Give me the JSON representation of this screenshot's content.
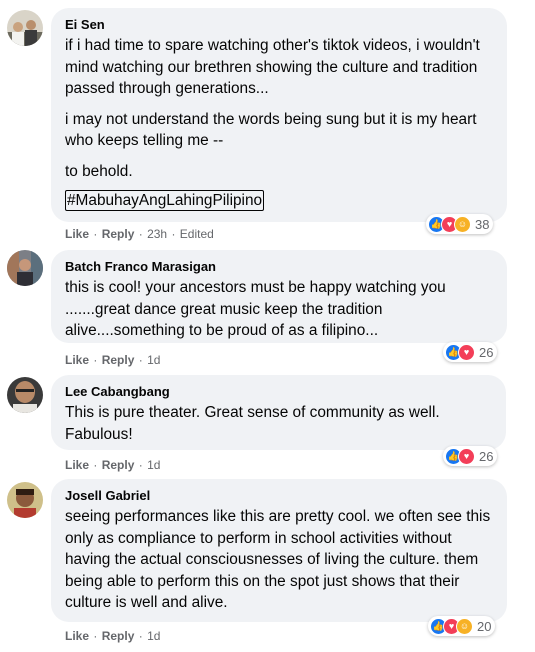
{
  "comments": [
    {
      "author": "Ei Sen",
      "paragraphs": [
        "if i had time to spare watching other's tiktok videos, i wouldn't mind watching our brethren showing the culture and tradition passed through generations...",
        "i may not understand the words being sung but it is my heart who keeps telling me --",
        "to behold."
      ],
      "hashtag": "#MabuhayAngLahingPilipino",
      "like_label": "Like",
      "reply_label": "Reply",
      "time": "23h",
      "edited": "Edited",
      "reaction_count": "38",
      "reactions": [
        "like-icon",
        "love-icon",
        "care-icon"
      ]
    },
    {
      "author": "Batch Franco Marasigan",
      "paragraphs": [
        "this is cool! your ancestors must be happy watching you .......great dance great music keep the tradition alive....something to be proud of as a filipino..."
      ],
      "like_label": "Like",
      "reply_label": "Reply",
      "time": "1d",
      "reaction_count": "26",
      "reactions": [
        "like-icon",
        "love-icon"
      ]
    },
    {
      "author": "Lee Cabangbang",
      "paragraphs": [
        "This is pure theater. Great sense of community as well. Fabulous!"
      ],
      "like_label": "Like",
      "reply_label": "Reply",
      "time": "1d",
      "reaction_count": "26",
      "reactions": [
        "like-icon",
        "love-icon"
      ]
    },
    {
      "author": "Josell Gabriel",
      "paragraphs": [
        "seeing performances like this are pretty cool. we often see this only as compliance to perform in school activities without having the actual consciousnesses of living the culture. them being able to perform this on the spot just shows that their culture is well and alive."
      ],
      "like_label": "Like",
      "reply_label": "Reply",
      "time": "1d",
      "reaction_count": "20",
      "reactions": [
        "like-icon",
        "love-icon",
        "care-icon"
      ]
    }
  ],
  "colors": {
    "bubble": "#f0f2f5",
    "meta": "#65676b",
    "like": "#1877f2",
    "love": "#f33e58",
    "care": "#f7b125"
  }
}
